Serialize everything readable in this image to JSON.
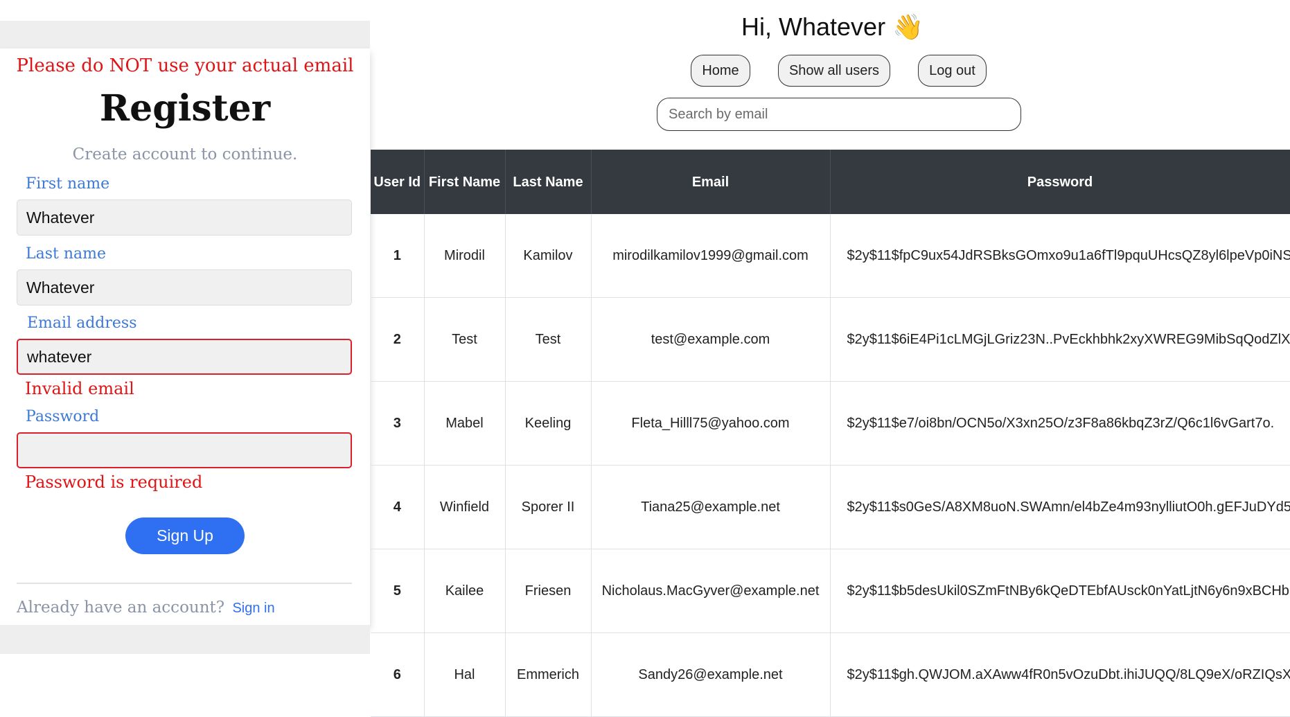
{
  "register": {
    "warning": "Please do NOT use your actual email",
    "title": "Register",
    "subtitle": "Create account to continue.",
    "first_name_label": "First name",
    "first_name_value": "Whatever",
    "last_name_label": "Last name",
    "last_name_value": "Whatever",
    "email_label": "Email address",
    "email_value": "whatever",
    "email_error": "Invalid email",
    "password_label": "Password",
    "password_value": "",
    "password_error": "Password is required",
    "signup_label": "Sign Up",
    "already_text": "Already have an account?",
    "signin_label": "Sign in"
  },
  "header": {
    "greeting": "Hi, Whatever 👋",
    "nav": [
      "Home",
      "Show all users",
      "Log out"
    ],
    "search_placeholder": "Search by email"
  },
  "table": {
    "headers": [
      "User Id",
      "First Name",
      "Last Name",
      "Email",
      "Password"
    ],
    "rows": [
      {
        "id": "1",
        "first": "Mirodil",
        "last": "Kamilov",
        "email": "mirodilkamilov1999@gmail.com",
        "password": "$2y$11$fpC9ux54JdRSBksGOmxo9u1a6fTl9pquUHcsQZ8yl6lpeVp0iNS"
      },
      {
        "id": "2",
        "first": "Test",
        "last": "Test",
        "email": "test@example.com",
        "password": "$2y$11$6iE4Pi1cLMGjLGriz23N..PvEckhbhk2xyXWREG9MibSqQodZlX"
      },
      {
        "id": "3",
        "first": "Mabel",
        "last": "Keeling",
        "email": "Fleta_Hilll75@yahoo.com",
        "password": "$2y$11$e7/oi8bn/OCN5o/X3xn25O/z3F8a86kbqZ3rZ/Q6c1l6vGart7o."
      },
      {
        "id": "4",
        "first": "Winfield",
        "last": "Sporer II",
        "email": "Tiana25@example.net",
        "password": "$2y$11$s0GeS/A8XM8uoN.SWAmn/el4bZe4m93nylliutO0h.gEFJuDYd5"
      },
      {
        "id": "5",
        "first": "Kailee",
        "last": "Friesen",
        "email": "Nicholaus.MacGyver@example.net",
        "password": "$2y$11$b5desUkil0SZmFtNBy6kQeDTEbfAUsck0nYatLjtN6y6n9xBCHb"
      },
      {
        "id": "6",
        "first": "Hal",
        "last": "Emmerich",
        "email": "Sandy26@example.net",
        "password": "$2y$11$gh.QWJOM.aXAww4fR0n5vOzuDbt.ihiJUQQ/8LQ9eX/oRZIQsX"
      }
    ]
  }
}
